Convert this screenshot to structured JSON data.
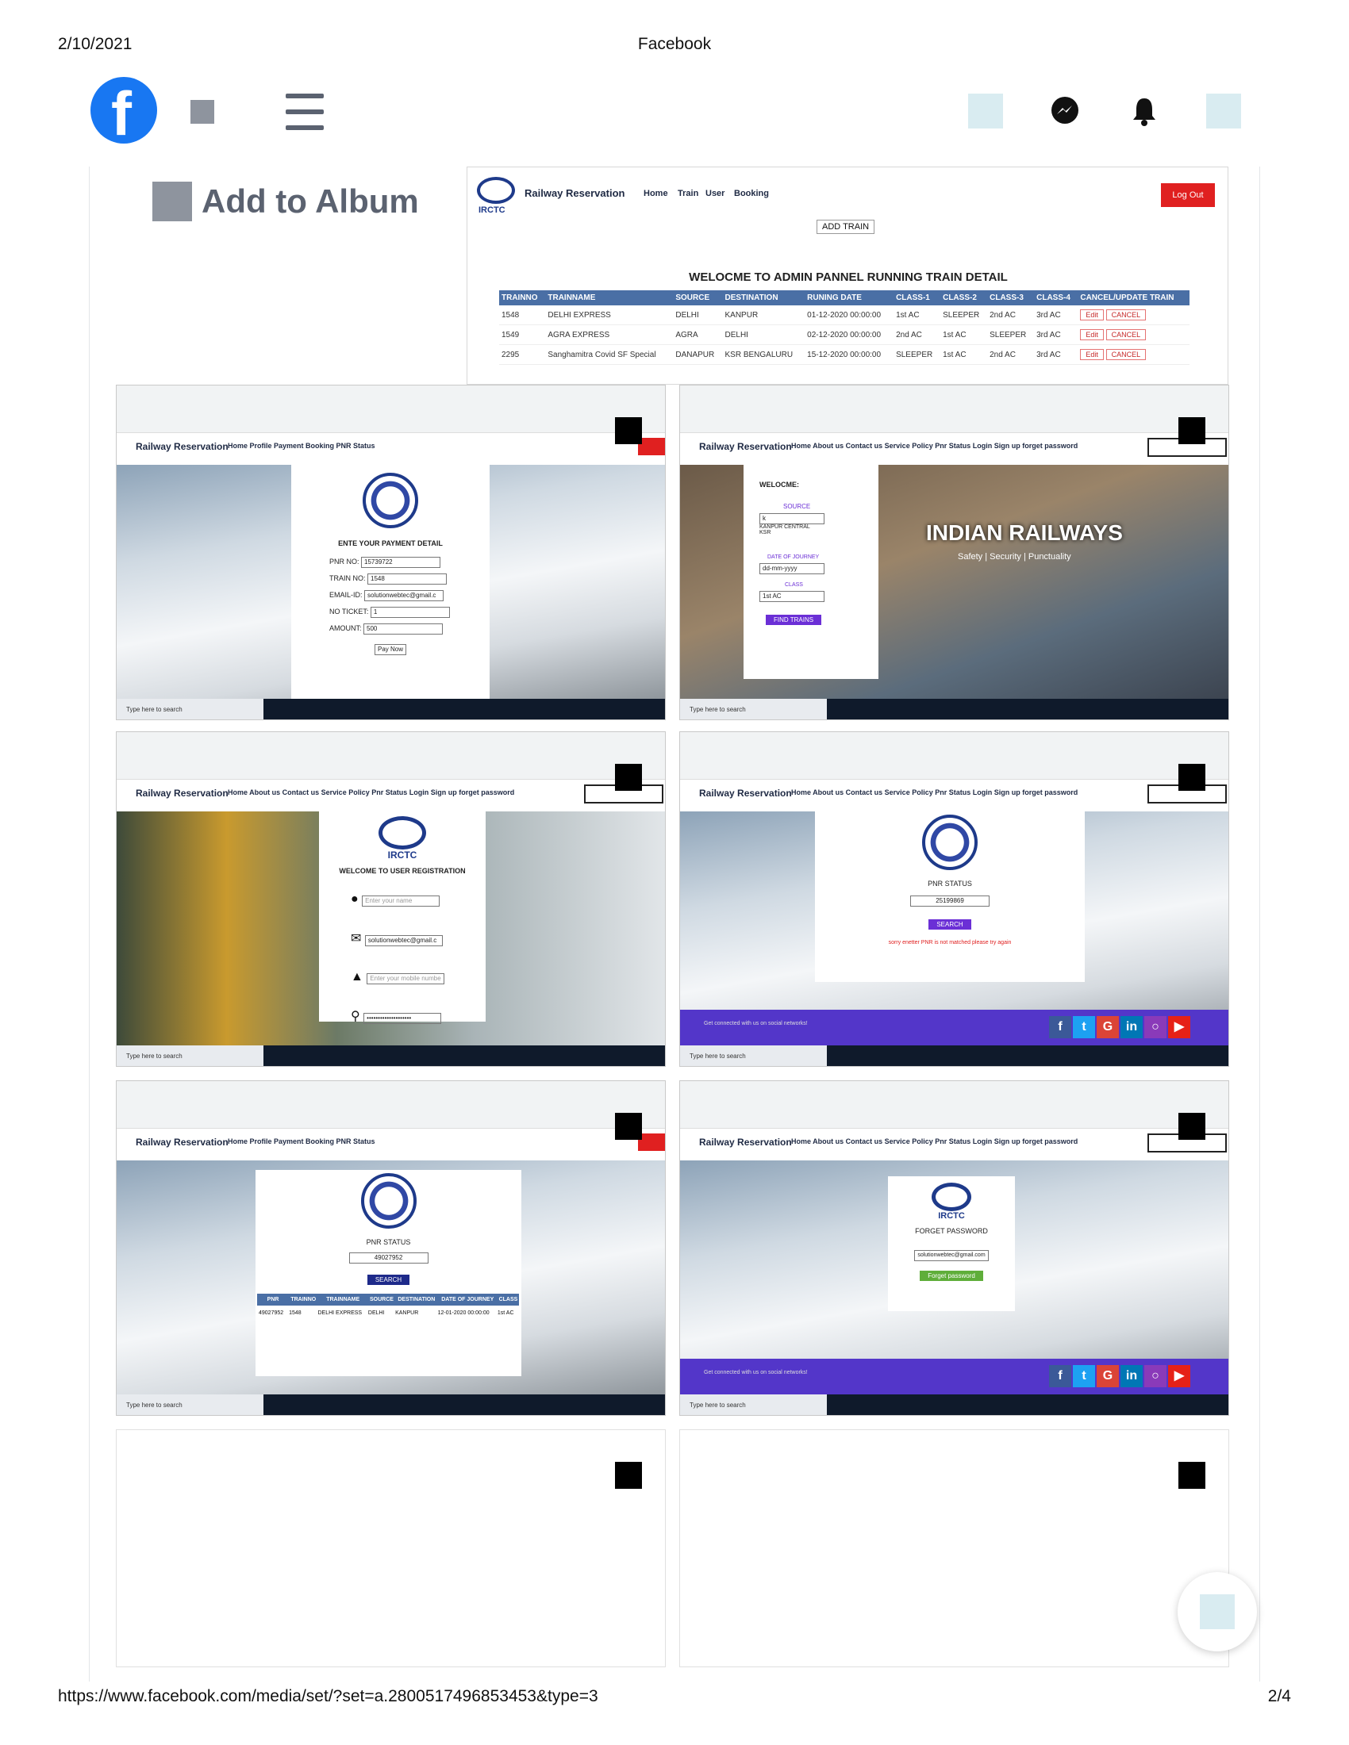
{
  "print": {
    "date": "2/10/2021",
    "title": "Facebook",
    "url": "https://www.facebook.com/media/set/?set=a.2800517496853453&type=3",
    "page": "2/4"
  },
  "nav": {
    "logo_letter": "f",
    "icons": [
      "facebook-logo",
      "menu-icon",
      "messenger-icon",
      "notifications-icon"
    ]
  },
  "album": {
    "add_label": "Add to Album"
  },
  "admin": {
    "brand": "Railway Reservation",
    "logo_text": "IRCTC",
    "nav": [
      "Home",
      "Train",
      "User",
      "Booking"
    ],
    "logout": "Log Out",
    "add_train": "ADD TRAIN",
    "heading": "WELOCME TO ADMIN PANNEL RUNNING TRAIN DETAIL",
    "columns": [
      "TRAINNO",
      "TRAINNAME",
      "SOURCE",
      "DESTINATION",
      "RUNING DATE",
      "CLASS-1",
      "CLASS-2",
      "CLASS-3",
      "CLASS-4",
      "CANCEL/UPDATE TRAIN"
    ],
    "rows": [
      [
        "1548",
        "DELHI EXPRESS",
        "DELHI",
        "KANPUR",
        "01-12-2020 00:00:00",
        "1st AC",
        "SLEEPER",
        "2nd AC",
        "3rd AC"
      ],
      [
        "1549",
        "AGRA EXPRESS",
        "AGRA",
        "DELHI",
        "02-12-2020 00:00:00",
        "2nd AC",
        "1st AC",
        "SLEEPER",
        "3rd AC"
      ],
      [
        "2295",
        "Sanghamitra Covid SF Special",
        "DANAPUR",
        "KSR BENGALURU",
        "15-12-2020 00:00:00",
        "SLEEPER",
        "1st AC",
        "2nd AC",
        "3rd AC"
      ]
    ],
    "edit": "Edit",
    "cancel": "CANCEL"
  },
  "tiles": {
    "brand": "Railway Reservation",
    "nav_user": "Home   Profile   Payment   Booking   PNR Status",
    "nav_public": "Home   About us   Contact us   Service Policy   Pnr Status        Login    Sign up    forget password",
    "taskbar_search": "Type here to search",
    "payment": {
      "heading": "ENTE YOUR PAYMENT DETAIL",
      "pnr_label": "PNR NO:",
      "pnr": "15739722",
      "train_label": "TRAIN NO:",
      "train": "1548",
      "email_label": "EMAIL-ID:",
      "email": "solutionwebtec@gmail.c",
      "ticket_label": "NO TICKET:",
      "ticket": "1",
      "amount_label": "AMOUNT:",
      "amount": "500",
      "button": "Pay Now"
    },
    "search": {
      "welcome": "WELOCME:",
      "source_label": "SOURCE",
      "source_value": "k",
      "suggest1": "KANPUR CENTRAL",
      "suggest2": "KSR",
      "doj_label": "DATE OF JOURNEY",
      "doj_placeholder": "dd-mm-yyyy",
      "class_label": "CLASS",
      "class_value": "1st AC",
      "button": "FIND TRAINS",
      "banner": "INDIAN RAILWAYS",
      "tagline": "Safety | Security | Punctuality"
    },
    "register": {
      "logo": "IRCTC",
      "heading": "WELCOME TO USER REGISTRATION",
      "name_ph": "Enter your name",
      "email": "solutionwebtec@gmail.c",
      "mobile_ph": "Enter your mobile numbe",
      "password": "••••••••••••••••••••"
    },
    "pnr_fail": {
      "heading": "PNR STATUS",
      "value": "25199869",
      "button": "SEARCH",
      "error": "sorry enetter PNR is not matched please try again",
      "social_text": "Get connected with us on social networks!"
    },
    "pnr_ok": {
      "heading": "PNR STATUS",
      "value": "49027952",
      "button": "SEARCH",
      "columns": [
        "PNR",
        "TRAINNO",
        "TRAINNAME",
        "SOURCE",
        "DESTINATION",
        "DATE OF JOURNEY",
        "CLASS"
      ],
      "row": [
        "49027952",
        "1548",
        "DELHI EXPRESS",
        "DELHI",
        "KANPUR",
        "12-01-2020 00:00:00",
        "1st AC"
      ]
    },
    "forget": {
      "logo": "IRCTC",
      "heading": "FORGET PASSWORD",
      "value": "solutionwebtec@gmail.com",
      "button": "Forget password",
      "social_text": "Get connected with us on social networks!"
    }
  }
}
